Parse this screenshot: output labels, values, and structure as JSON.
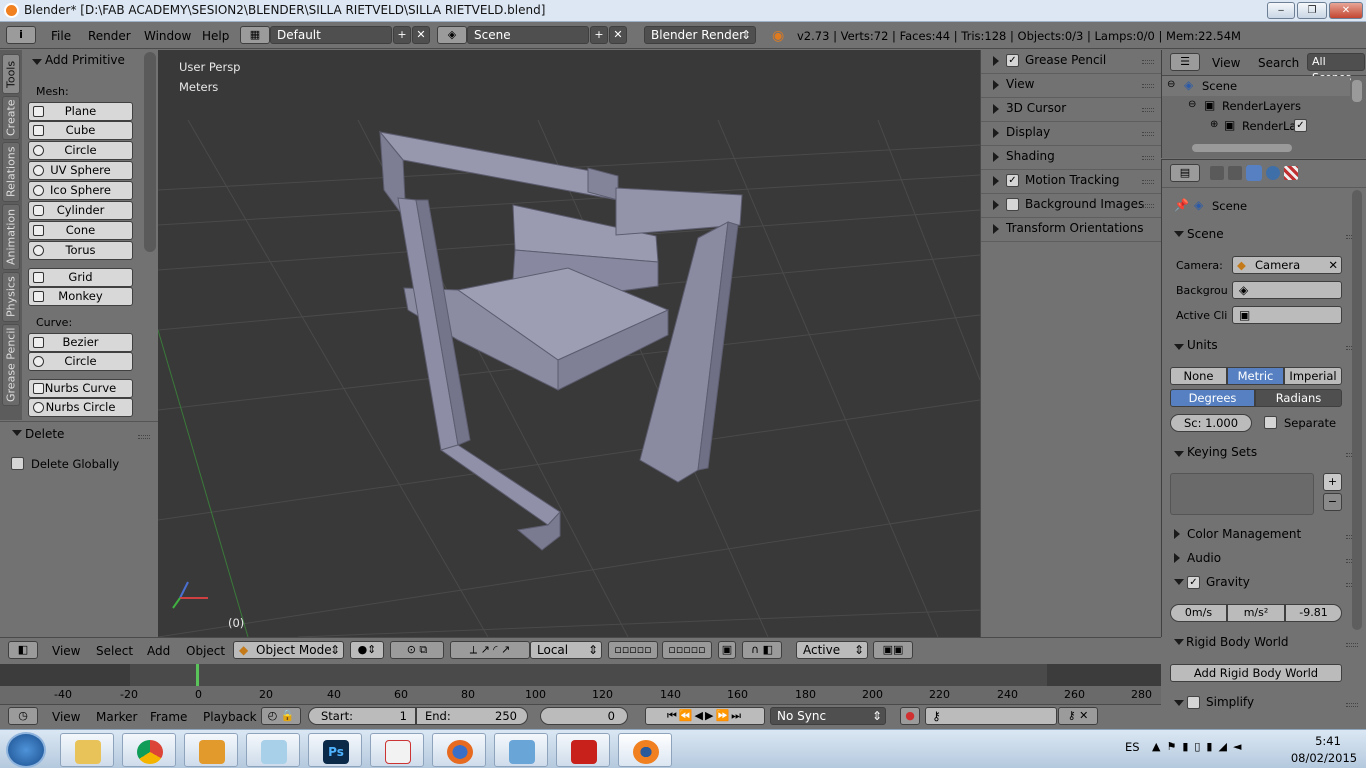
{
  "window": {
    "title": "Blender* [D:\\FAB ACADEMY\\SESION2\\BLENDER\\SILLA RIETVELD\\SILLA RIETVELD.blend]",
    "minimize": "‒",
    "maximize": "❐",
    "close": "✕"
  },
  "topbar": {
    "info_icon": "i",
    "menus": [
      "File",
      "Render",
      "Window",
      "Help"
    ],
    "screen_layout": "Default",
    "scene": "Scene",
    "engine": "Blender Render",
    "stats": "v2.73 | Verts:72 | Faces:44 | Tris:128 | Objects:0/3 | Lamps:0/0 | Mem:22.54M"
  },
  "tool_tabs": [
    "Tools",
    "Create",
    "Relations",
    "Animation",
    "Physics",
    "Grease Pencil"
  ],
  "toolshelf": {
    "panel_title": "Add Primitive",
    "mesh_label": "Mesh:",
    "mesh_items": [
      "Plane",
      "Cube",
      "Circle",
      "UV Sphere",
      "Ico Sphere",
      "Cylinder",
      "Cone",
      "Torus"
    ],
    "mesh_items2": [
      "Grid",
      "Monkey"
    ],
    "curve_label": "Curve:",
    "curve_items": [
      "Bezier",
      "Circle"
    ],
    "nurbs_items": [
      "Nurbs Curve",
      "Nurbs Circle"
    ]
  },
  "delete_panel": {
    "title": "Delete",
    "option": "Delete Globally"
  },
  "viewport": {
    "view_label": "User Persp",
    "units_label": "Meters",
    "frame_label": "(0)",
    "bg_color": "#393939",
    "object_color": "#8f8fa8"
  },
  "npanel": {
    "items": [
      {
        "label": "Grease Pencil",
        "checkbox": true,
        "checked": true
      },
      {
        "label": "View",
        "checkbox": false
      },
      {
        "label": "3D Cursor",
        "checkbox": false
      },
      {
        "label": "Display",
        "checkbox": false
      },
      {
        "label": "Shading",
        "checkbox": false
      },
      {
        "label": "Motion Tracking",
        "checkbox": true,
        "checked": true
      },
      {
        "label": "Background Images",
        "checkbox": true,
        "checked": false
      },
      {
        "label": "Transform Orientations",
        "checkbox": false
      }
    ]
  },
  "outliner": {
    "view": "View",
    "search": "Search",
    "filter": "All Scenes",
    "tree": [
      "Scene",
      "RenderLayers",
      "RenderLa"
    ]
  },
  "properties": {
    "context": "Scene",
    "scene_panel": {
      "title": "Scene",
      "camera_label": "Camera:",
      "camera_value": "Camera",
      "background_label": "Backgrou",
      "active_clip_label": "Active Cli"
    },
    "units_panel": {
      "title": "Units",
      "systems": [
        "None",
        "Metric",
        "Imperial"
      ],
      "rotation": [
        "Degrees",
        "Radians"
      ],
      "scale": "Sc: 1.000",
      "separate": "Separate"
    },
    "keying_sets": {
      "title": "Keying Sets",
      "add": "+",
      "remove": "−"
    },
    "color_management": "Color Management",
    "audio": "Audio",
    "gravity": {
      "title": "Gravity",
      "x": "0m/s",
      "y": "m/s²",
      "z": "-9.81"
    },
    "rigid_body": {
      "title": "Rigid Body World",
      "button": "Add Rigid Body World"
    },
    "simplify": "Simplify",
    "accent": "#5680c2"
  },
  "view3d_header": {
    "menus": [
      "View",
      "Select",
      "Add",
      "Object"
    ],
    "mode": "Object Mode",
    "orientation": "Local",
    "pivot": "Active"
  },
  "timeline": {
    "ticks": [
      "-40",
      "-20",
      "0",
      "20",
      "40",
      "60",
      "80",
      "100",
      "120",
      "140",
      "160",
      "180",
      "200",
      "220",
      "240",
      "260",
      "280"
    ],
    "menus": [
      "View",
      "Marker",
      "Frame",
      "Playback"
    ],
    "start_label": "Start:",
    "start": "1",
    "end_label": "End:",
    "end": "250",
    "current": "0",
    "sync": "No Sync"
  },
  "taskbar": {
    "apps": [
      "Explorer",
      "Chrome",
      "Media Player",
      "Notepad",
      "Photoshop",
      "Acrobat",
      "Firefox",
      "Photos",
      "AutoCAD",
      "Blender"
    ],
    "ps_label": "Ps",
    "lang": "ES",
    "time": "5:41",
    "date": "08/02/2015"
  }
}
